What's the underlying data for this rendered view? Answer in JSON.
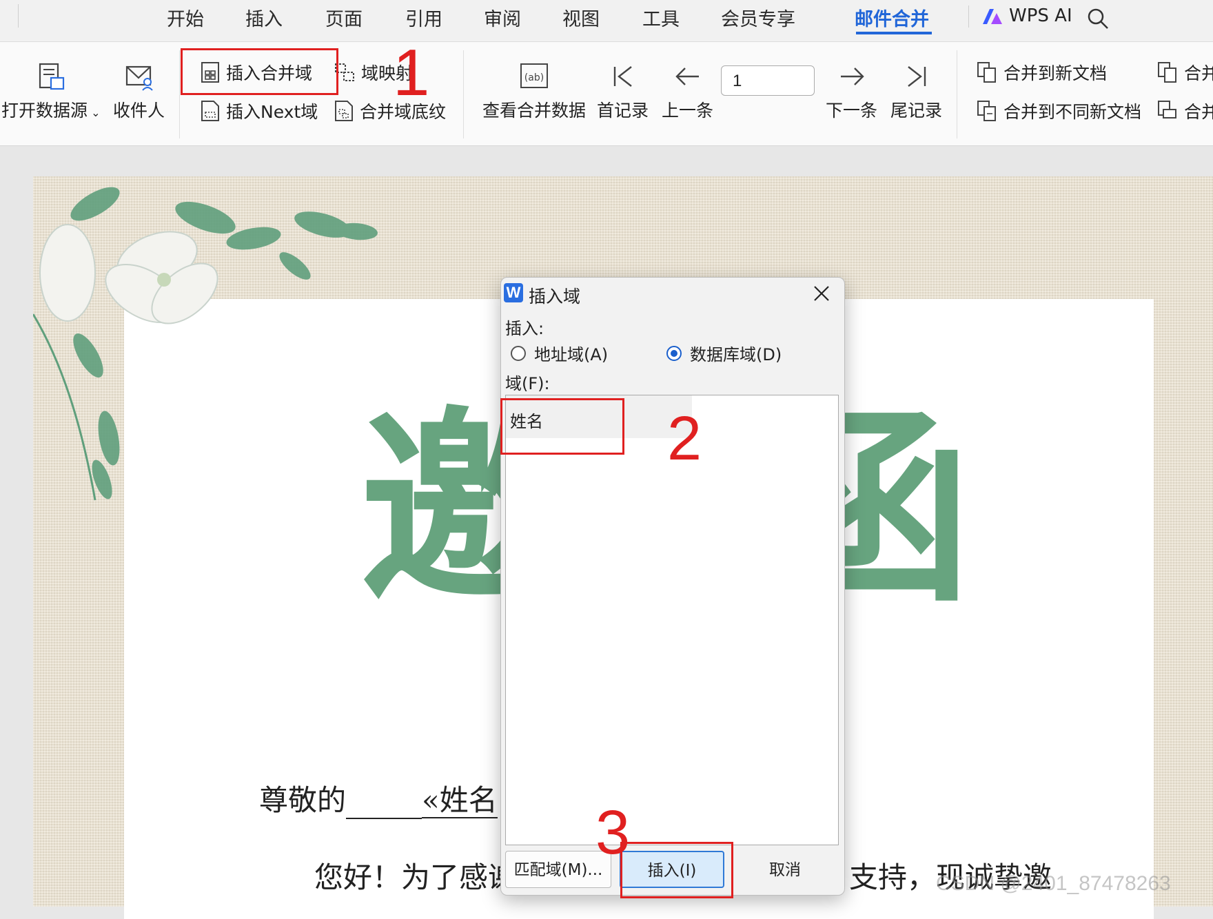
{
  "menu": {
    "tabs": [
      "开始",
      "插入",
      "页面",
      "引用",
      "审阅",
      "视图",
      "工具",
      "会员专享",
      "邮件合并"
    ],
    "active_tab": "邮件合并",
    "wps_ai": "WPS AI"
  },
  "ribbon": {
    "open_source": "打开数据源",
    "recipients": "收件人",
    "insert_merge_field": "插入合并域",
    "field_mapping": "域映射",
    "insert_next_field": "插入Next域",
    "field_shading": "合并域底纹",
    "view_merged_data": "查看合并数据",
    "first_record": "首记录",
    "prev_record": "上一条",
    "record_number": "1",
    "next_record": "下一条",
    "last_record": "尾记录",
    "merge_to_new_doc": "合并到新文档",
    "merge_to_diff_docs": "合并到不同新文档",
    "merge_cut_1": "合并",
    "merge_cut_2": "合并"
  },
  "annotations": {
    "n1": "1",
    "n2": "2",
    "n3": "3"
  },
  "document": {
    "title_left": "邀",
    "title_right": "函",
    "salute": "尊敬的",
    "field": "«姓名",
    "body_left": "您好！为了感谢",
    "body_right": "支持，现诚挚邀",
    "watermark": "CSDN @2401_87478263"
  },
  "dialog": {
    "title": "插入域",
    "insert_label": "插入:",
    "radio_address": "地址域(A)",
    "radio_database": "数据库域(D)",
    "selected_radio": "database",
    "field_label": "域(F):",
    "fields": [
      "姓名"
    ],
    "btn_match": "匹配域(M)...",
    "btn_insert": "插入(I)",
    "btn_cancel": "取消"
  },
  "colors": {
    "accent": "#2166d8",
    "title_green": "#67a47f",
    "annotation_red": "#e02020"
  }
}
